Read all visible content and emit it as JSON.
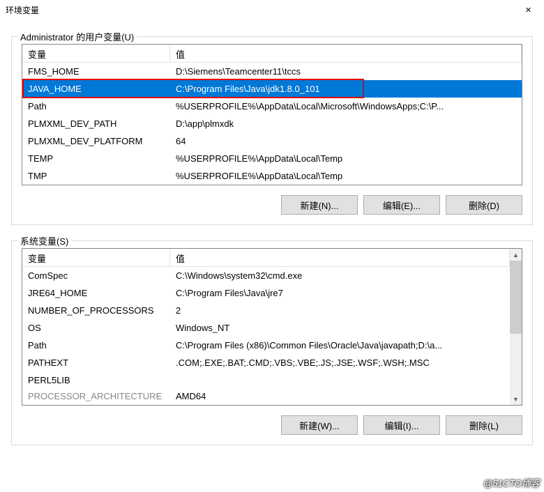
{
  "window": {
    "title": "环境变量",
    "close_icon": "×"
  },
  "user_vars": {
    "group_label": "Administrator 的用户变量(U)",
    "col_var": "变量",
    "col_val": "值",
    "rows": [
      {
        "name": "FMS_HOME",
        "value": "D:\\Siemens\\Teamcenter11\\tccs"
      },
      {
        "name": "JAVA_HOME",
        "value": "C:\\Program Files\\Java\\jdk1.8.0_101"
      },
      {
        "name": "Path",
        "value": "%USERPROFILE%\\AppData\\Local\\Microsoft\\WindowsApps;C:\\P..."
      },
      {
        "name": "PLMXML_DEV_PATH",
        "value": "D:\\app\\plmxdk"
      },
      {
        "name": "PLMXML_DEV_PLATFORM",
        "value": "64"
      },
      {
        "name": "TEMP",
        "value": "%USERPROFILE%\\AppData\\Local\\Temp"
      },
      {
        "name": "TMP",
        "value": "%USERPROFILE%\\AppData\\Local\\Temp"
      }
    ],
    "buttons": {
      "new": "新建(N)...",
      "edit": "编辑(E)...",
      "delete": "删除(D)"
    }
  },
  "system_vars": {
    "group_label": "系统变量(S)",
    "col_var": "变量",
    "col_val": "值",
    "rows": [
      {
        "name": "ComSpec",
        "value": "C:\\Windows\\system32\\cmd.exe"
      },
      {
        "name": "JRE64_HOME",
        "value": "C:\\Program Files\\Java\\jre7"
      },
      {
        "name": "NUMBER_OF_PROCESSORS",
        "value": "2"
      },
      {
        "name": "OS",
        "value": "Windows_NT"
      },
      {
        "name": "Path",
        "value": "C:\\Program Files (x86)\\Common Files\\Oracle\\Java\\javapath;D:\\a..."
      },
      {
        "name": "PATHEXT",
        "value": ".COM;.EXE;.BAT;.CMD;.VBS;.VBE;.JS;.JSE;.WSF;.WSH;.MSC"
      },
      {
        "name": "PERL5LIB",
        "value": ""
      },
      {
        "name": "PROCESSOR_ARCHITECTURE",
        "value": "AMD64"
      }
    ],
    "buttons": {
      "new": "新建(W)...",
      "edit": "编辑(I)...",
      "delete": "删除(L)"
    }
  },
  "watermark": "@51CTO博客"
}
